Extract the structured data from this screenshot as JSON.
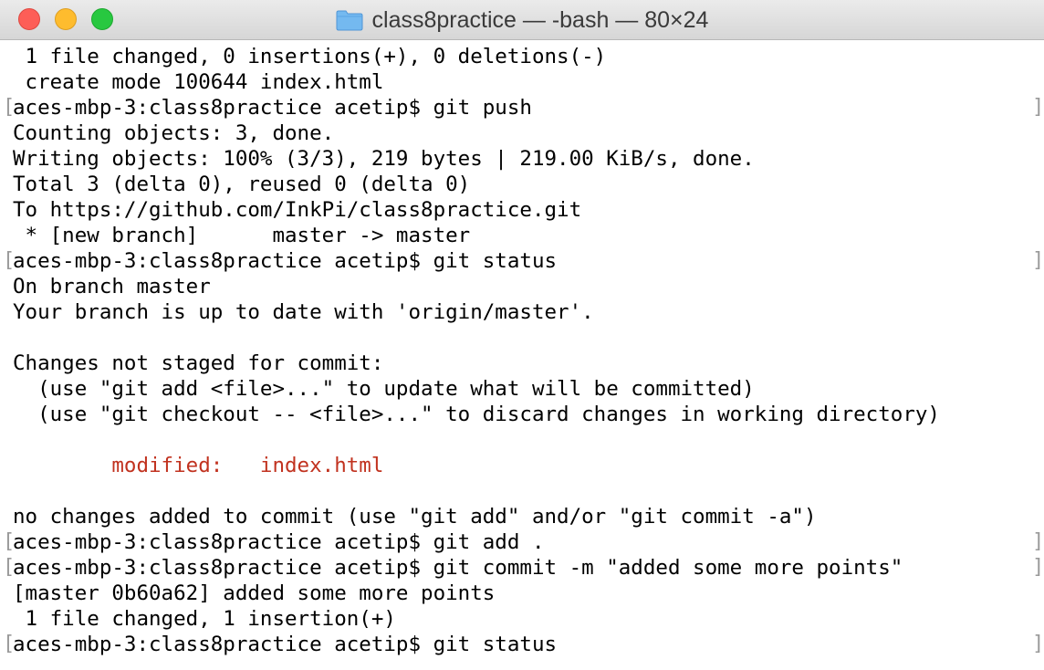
{
  "window": {
    "title": "class8practice — -bash — 80×24",
    "folder_icon": "folder-icon",
    "controls": {
      "close": "close-button",
      "minimize": "minimize-button",
      "zoom": "zoom-button"
    }
  },
  "colors": {
    "error_red": "#c1321f",
    "text": "#000000",
    "background": "#ffffff"
  },
  "terminal": {
    "lines": [
      {
        "text": " 1 file changed, 0 insertions(+), 0 deletions(-)"
      },
      {
        "text": " create mode 100644 index.html"
      },
      {
        "text": "aces-mbp-3:class8practice acetip$ git push",
        "prompt": true
      },
      {
        "text": "Counting objects: 3, done."
      },
      {
        "text": "Writing objects: 100% (3/3), 219 bytes | 219.00 KiB/s, done."
      },
      {
        "text": "Total 3 (delta 0), reused 0 (delta 0)"
      },
      {
        "text": "To https://github.com/InkPi/class8practice.git"
      },
      {
        "text": " * [new branch]      master -> master"
      },
      {
        "text": "aces-mbp-3:class8practice acetip$ git status",
        "prompt": true
      },
      {
        "text": "On branch master"
      },
      {
        "text": "Your branch is up to date with 'origin/master'."
      },
      {
        "text": ""
      },
      {
        "text": "Changes not staged for commit:"
      },
      {
        "text": "  (use \"git add <file>...\" to update what will be committed)"
      },
      {
        "text": "  (use \"git checkout -- <file>...\" to discard changes in working directory)"
      },
      {
        "text": ""
      },
      {
        "text": "        modified:   index.html",
        "red": true
      },
      {
        "text": ""
      },
      {
        "text": "no changes added to commit (use \"git add\" and/or \"git commit -a\")"
      },
      {
        "text": "aces-mbp-3:class8practice acetip$ git add .",
        "prompt": true
      },
      {
        "text": "aces-mbp-3:class8practice acetip$ git commit -m \"added some more points\"",
        "prompt": true
      },
      {
        "text": "[master 0b60a62] added some more points"
      },
      {
        "text": " 1 file changed, 1 insertion(+)"
      },
      {
        "text": "aces-mbp-3:class8practice acetip$ git status",
        "prompt": true
      }
    ]
  }
}
